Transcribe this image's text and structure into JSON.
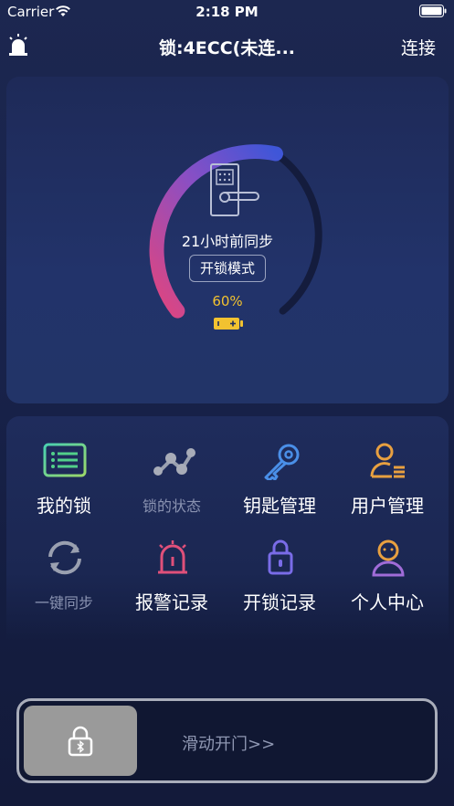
{
  "status_bar": {
    "carrier": "Carrier",
    "time": "2:18 PM"
  },
  "nav": {
    "title": "锁:4ECC(未连...",
    "connect_label": "连接"
  },
  "lock_status": {
    "sync_text": "21小时前同步",
    "mode_label": "开锁模式",
    "battery_percent": "60%",
    "battery_level": 0.6
  },
  "menu": {
    "items": [
      {
        "label": "我的锁",
        "icon": "lock-list-icon",
        "enabled": true
      },
      {
        "label": "锁的状态",
        "icon": "lock-status-icon",
        "enabled": false
      },
      {
        "label": "钥匙管理",
        "icon": "key-icon",
        "enabled": true
      },
      {
        "label": "用户管理",
        "icon": "user-manage-icon",
        "enabled": true
      },
      {
        "label": "一键同步",
        "icon": "sync-icon",
        "enabled": false
      },
      {
        "label": "报警记录",
        "icon": "alarm-icon",
        "enabled": true
      },
      {
        "label": "开锁记录",
        "icon": "unlock-record-icon",
        "enabled": true
      },
      {
        "label": "个人中心",
        "icon": "profile-icon",
        "enabled": true
      }
    ]
  },
  "slider": {
    "label": "滑动开门>>"
  },
  "colors": {
    "background": "#18224a",
    "ring_start": "#e0457f",
    "ring_end": "#3f56d8",
    "ring_track": "#141c3d",
    "battery": "#f2c230",
    "menu_green": "#52d08a",
    "menu_blue": "#4a8fe8",
    "menu_orange": "#e8a040",
    "menu_pink": "#e0507a",
    "menu_purple": "#7a6ce8"
  }
}
